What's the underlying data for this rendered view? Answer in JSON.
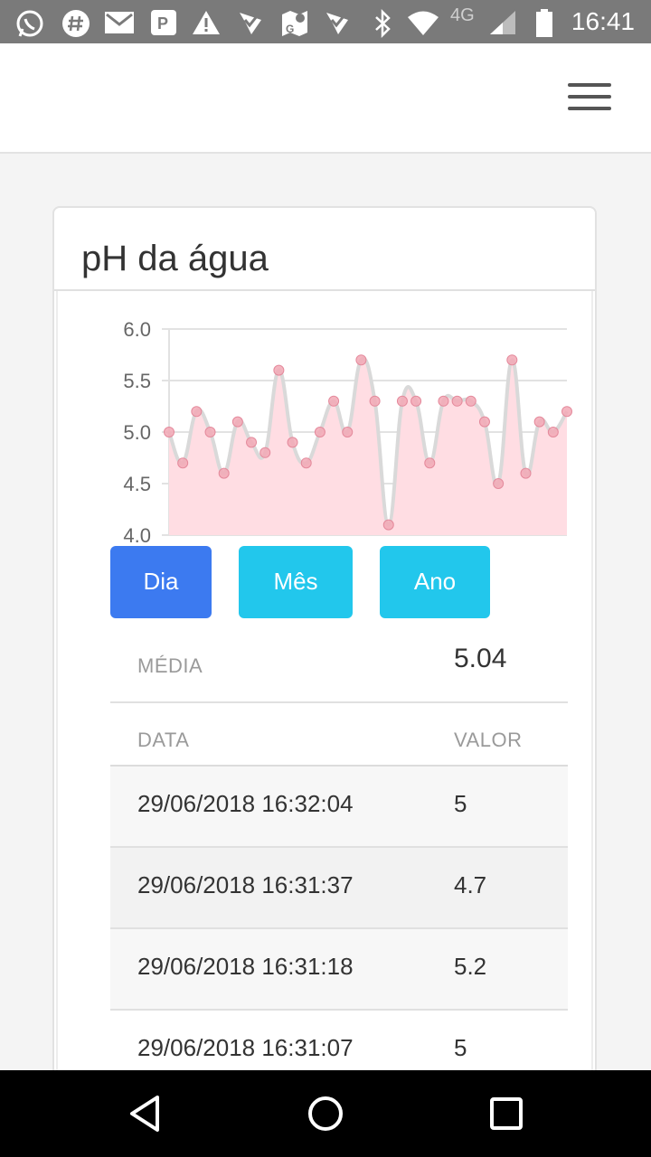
{
  "status_bar": {
    "network_label": "4G",
    "time": "16:41",
    "icons": [
      "whatsapp-icon",
      "hashtag-icon",
      "gmail-icon",
      "parking-icon",
      "warning-icon",
      "check-app-icon",
      "maps-icon",
      "check-app-icon",
      "bluetooth-icon",
      "wifi-icon",
      "cell-signal-icon",
      "battery-icon"
    ]
  },
  "header": {
    "menu_icon": "hamburger-menu-icon"
  },
  "card": {
    "title": "pH da água",
    "range_buttons": [
      "Dia",
      "Mês",
      "Ano"
    ],
    "active_range": "Dia",
    "average_label": "MÉDIA",
    "average_value": "5.04",
    "table": {
      "headers": [
        "DATA",
        "VALOR"
      ],
      "rows": [
        {
          "date": "29/06/2018 16:32:04",
          "value": "5"
        },
        {
          "date": "29/06/2018 16:31:37",
          "value": "4.7"
        },
        {
          "date": "29/06/2018 16:31:18",
          "value": "5.2"
        },
        {
          "date": "29/06/2018 16:31:07",
          "value": "5"
        }
      ]
    }
  },
  "chart_data": {
    "type": "area",
    "title": "",
    "xlabel": "",
    "ylabel": "",
    "ylim": [
      4.0,
      6.0
    ],
    "y_ticks": [
      "6.0",
      "5.5",
      "5.0",
      "4.5",
      "4.0"
    ],
    "grid": true,
    "legend": "none",
    "line_color": "#d9d9d9",
    "fill_color": "#ffdde3",
    "point_color": "#f2a8b5",
    "values": [
      5.0,
      4.7,
      5.2,
      5.0,
      4.6,
      5.1,
      4.9,
      4.8,
      5.6,
      4.9,
      4.7,
      5.0,
      5.3,
      5.0,
      5.7,
      5.3,
      4.1,
      5.3,
      5.3,
      4.7,
      5.3,
      5.3,
      5.3,
      5.1,
      4.5,
      5.7,
      4.6,
      5.1,
      5.0,
      5.2
    ]
  },
  "nav_bar": {
    "icons": [
      "back-icon",
      "home-icon",
      "recents-icon"
    ]
  }
}
